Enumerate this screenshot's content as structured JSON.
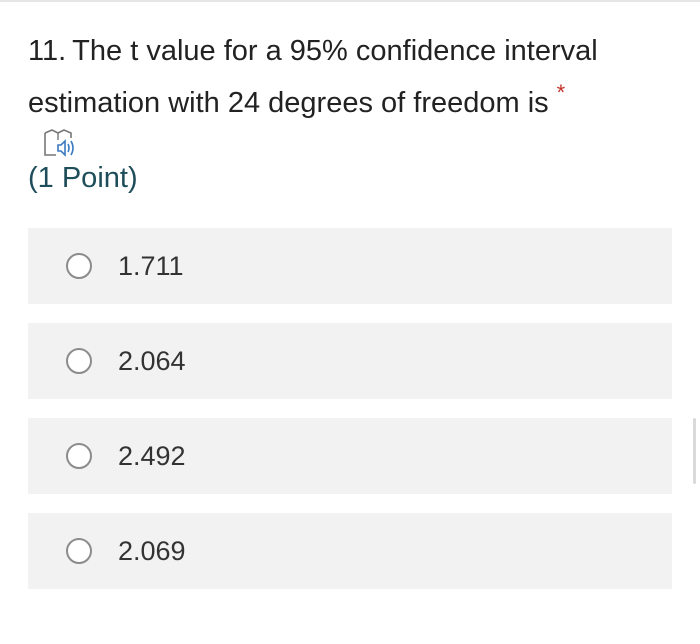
{
  "question": {
    "number": "11.",
    "line1": "The t value for a 95% confidence interval",
    "line2": "estimation with 24 degrees of freedom is",
    "required_marker": "*",
    "points": "(1 Point)",
    "speaker_icon": "immersive-reader-speaker-icon"
  },
  "options": [
    {
      "label": "1.711"
    },
    {
      "label": "2.064"
    },
    {
      "label": "2.492"
    },
    {
      "label": "2.069"
    }
  ],
  "colors": {
    "option_background": "#f2f2f2",
    "required_marker": "#c4312a",
    "points_text": "#1f4e5a"
  }
}
